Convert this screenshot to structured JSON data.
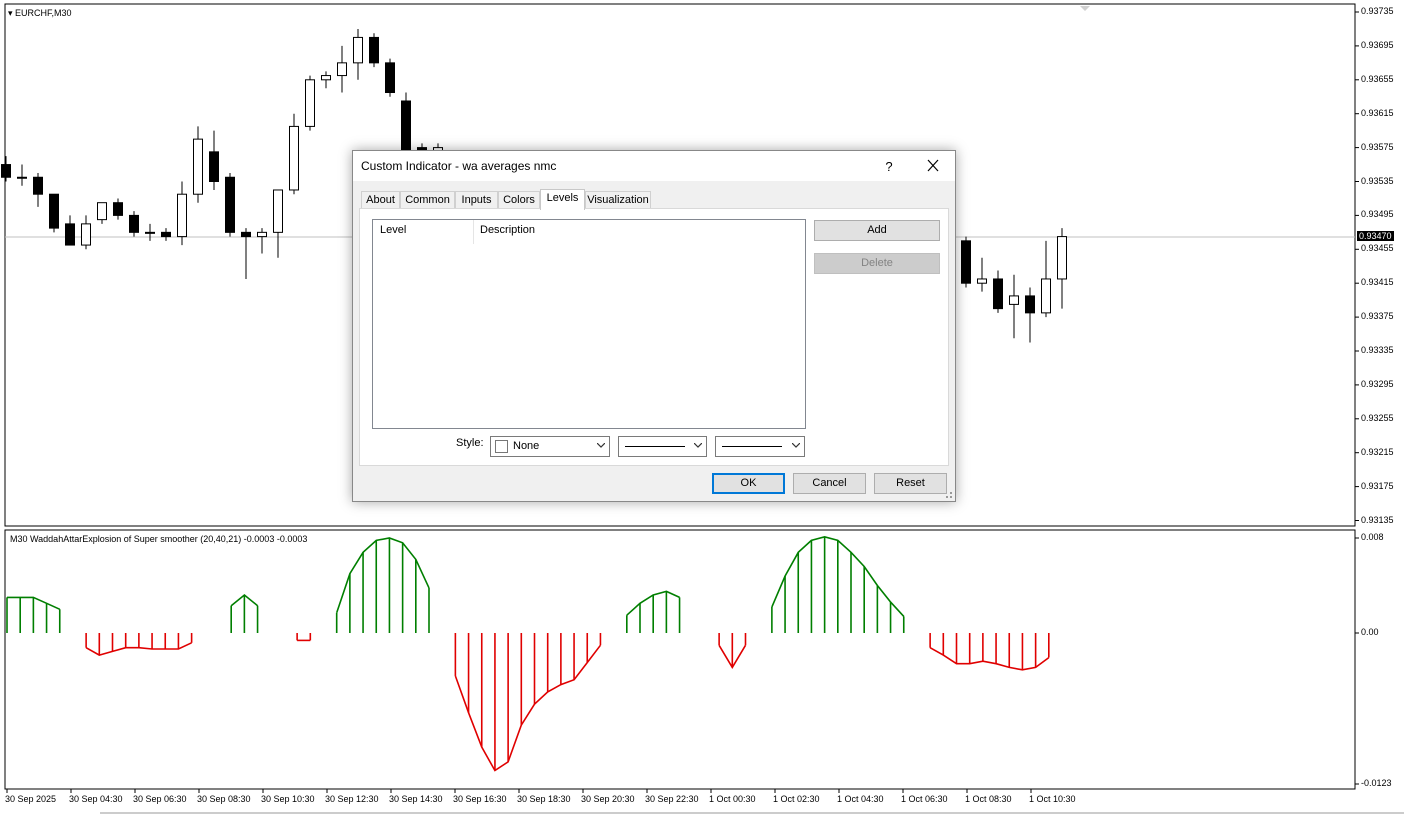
{
  "chart": {
    "symbol_label": "EURCHF,M30",
    "indicator_label": "M30  WaddahAttarExplosion of Super smoother (20,40,21) -0.0003 -0.0003",
    "current_price": "0.93470",
    "price_axis": [
      "0.93735",
      "0.93695",
      "0.93655",
      "0.93615",
      "0.93575",
      "0.93535",
      "0.93495",
      "0.93455",
      "0.93415",
      "0.93375",
      "0.93335",
      "0.93295",
      "0.93255",
      "0.93215",
      "0.93175",
      "0.93135"
    ],
    "indicator_axis": [
      "0.008",
      "0.00",
      "-0.0123"
    ],
    "time_axis": [
      "30 Sep 2025",
      "30 Sep 04:30",
      "30 Sep 06:30",
      "30 Sep 08:30",
      "30 Sep 10:30",
      "30 Sep 12:30",
      "30 Sep 14:30",
      "30 Sep 16:30",
      "30 Sep 18:30",
      "30 Sep 20:30",
      "30 Sep 22:30",
      "1 Oct 00:30",
      "1 Oct 02:30",
      "1 Oct 04:30",
      "1 Oct 06:30",
      "1 Oct 08:30",
      "1 Oct 10:30"
    ],
    "colors": {
      "up": "#ffffff",
      "down": "#000000",
      "hist_pos": "#007f00",
      "hist_neg": "#e00000"
    }
  },
  "chart_data": [
    {
      "type": "candlestick",
      "series": [
        {
          "name": "EURCHF,M30"
        }
      ],
      "ylim": [
        0.93135,
        0.93735
      ],
      "candles": [
        {
          "o": 0.93555,
          "h": 0.93565,
          "l": 0.93535,
          "c": 0.9354
        },
        {
          "o": 0.9354,
          "h": 0.93555,
          "l": 0.9353,
          "c": 0.9354
        },
        {
          "o": 0.9354,
          "h": 0.93545,
          "l": 0.93505,
          "c": 0.9352
        },
        {
          "o": 0.9352,
          "h": 0.9352,
          "l": 0.93475,
          "c": 0.9348
        },
        {
          "o": 0.93485,
          "h": 0.93495,
          "l": 0.9346,
          "c": 0.9346
        },
        {
          "o": 0.9346,
          "h": 0.93495,
          "l": 0.93455,
          "c": 0.93485
        },
        {
          "o": 0.9349,
          "h": 0.9351,
          "l": 0.93485,
          "c": 0.9351
        },
        {
          "o": 0.9351,
          "h": 0.93515,
          "l": 0.9349,
          "c": 0.93495
        },
        {
          "o": 0.93495,
          "h": 0.935,
          "l": 0.9347,
          "c": 0.93475
        },
        {
          "o": 0.93475,
          "h": 0.93485,
          "l": 0.93465,
          "c": 0.93475
        },
        {
          "o": 0.93475,
          "h": 0.9348,
          "l": 0.93465,
          "c": 0.9347
        },
        {
          "o": 0.9347,
          "h": 0.93535,
          "l": 0.9346,
          "c": 0.9352
        },
        {
          "o": 0.9352,
          "h": 0.936,
          "l": 0.9351,
          "c": 0.93585
        },
        {
          "o": 0.9357,
          "h": 0.93595,
          "l": 0.93525,
          "c": 0.93535
        },
        {
          "o": 0.9354,
          "h": 0.93545,
          "l": 0.9347,
          "c": 0.93475
        },
        {
          "o": 0.93475,
          "h": 0.9348,
          "l": 0.9342,
          "c": 0.9347
        },
        {
          "o": 0.9347,
          "h": 0.9348,
          "l": 0.9345,
          "c": 0.93475
        },
        {
          "o": 0.93475,
          "h": 0.93525,
          "l": 0.93445,
          "c": 0.93525
        },
        {
          "o": 0.93525,
          "h": 0.93615,
          "l": 0.9352,
          "c": 0.936
        },
        {
          "o": 0.936,
          "h": 0.9366,
          "l": 0.93595,
          "c": 0.93655
        },
        {
          "o": 0.93655,
          "h": 0.93665,
          "l": 0.93645,
          "c": 0.9366
        },
        {
          "o": 0.9366,
          "h": 0.93695,
          "l": 0.9364,
          "c": 0.93675
        },
        {
          "o": 0.93675,
          "h": 0.93715,
          "l": 0.93655,
          "c": 0.93705
        },
        {
          "o": 0.93705,
          "h": 0.9371,
          "l": 0.9367,
          "c": 0.93675
        },
        {
          "o": 0.93675,
          "h": 0.9368,
          "l": 0.93635,
          "c": 0.9364
        },
        {
          "o": 0.9363,
          "h": 0.9364,
          "l": 0.9356,
          "c": 0.9357
        },
        {
          "o": 0.93575,
          "h": 0.9358,
          "l": 0.9354,
          "c": 0.9357
        },
        {
          "o": 0.9357,
          "h": 0.9358,
          "l": 0.9355,
          "c": 0.93575
        },
        {
          "o": 0.93465,
          "h": 0.9347,
          "l": 0.9341,
          "c": 0.93415
        },
        {
          "o": 0.93415,
          "h": 0.93445,
          "l": 0.93405,
          "c": 0.9342
        },
        {
          "o": 0.9342,
          "h": 0.9343,
          "l": 0.9338,
          "c": 0.93385
        },
        {
          "o": 0.9339,
          "h": 0.93425,
          "l": 0.9335,
          "c": 0.934
        },
        {
          "o": 0.934,
          "h": 0.9341,
          "l": 0.93345,
          "c": 0.9338
        },
        {
          "o": 0.9338,
          "h": 0.93465,
          "l": 0.93375,
          "c": 0.9342
        },
        {
          "o": 0.9342,
          "h": 0.9348,
          "l": 0.93385,
          "c": 0.9347
        }
      ]
    },
    {
      "type": "bar",
      "series": [
        {
          "name": "WaddahAttarExplosion of Super smoother (20,40,21)"
        }
      ],
      "ylim": [
        -0.0123,
        0.008
      ],
      "values": [
        0.003,
        0.003,
        0.003,
        0.0025,
        0.002,
        0.0,
        -0.0012,
        -0.0018,
        -0.0015,
        -0.0012,
        -0.0012,
        -0.0013,
        -0.0013,
        -0.0013,
        -0.0008,
        0.0,
        0.0,
        0.0023,
        0.0032,
        0.0023,
        0.0,
        0.0,
        -0.0006,
        -0.0006,
        0.0,
        0.0017,
        0.005,
        0.0068,
        0.0078,
        0.008,
        0.0076,
        0.0062,
        0.0038,
        0.0,
        -0.0035,
        -0.0065,
        -0.0093,
        -0.0112,
        -0.0105,
        -0.0075,
        -0.0058,
        -0.0048,
        -0.0042,
        -0.0038,
        -0.0024,
        -0.001,
        0.0,
        0.0015,
        0.0025,
        0.0032,
        0.0035,
        0.003,
        0.0,
        0.0,
        -0.001,
        -0.0028,
        -0.001,
        0.0,
        0.0022,
        0.0048,
        0.0068,
        0.0078,
        0.0081,
        0.0078,
        0.0068,
        0.0056,
        0.004,
        0.0026,
        0.0014,
        0.0,
        -0.0012,
        -0.0018,
        -0.0025,
        -0.0025,
        -0.0023,
        -0.0025,
        -0.0028,
        -0.003,
        -0.0028,
        -0.002,
        0.0
      ]
    }
  ],
  "dialog": {
    "title": "Custom Indicator - wa averages nmc",
    "help": "?",
    "tabs": [
      "About",
      "Common",
      "Inputs",
      "Colors",
      "Levels",
      "Visualization"
    ],
    "active_tab": "Levels",
    "columns": [
      "Level",
      "Description"
    ],
    "add_label": "Add",
    "delete_label": "Delete",
    "style_label": "Style:",
    "style_color": "None",
    "ok_label": "OK",
    "cancel_label": "Cancel",
    "reset_label": "Reset"
  }
}
